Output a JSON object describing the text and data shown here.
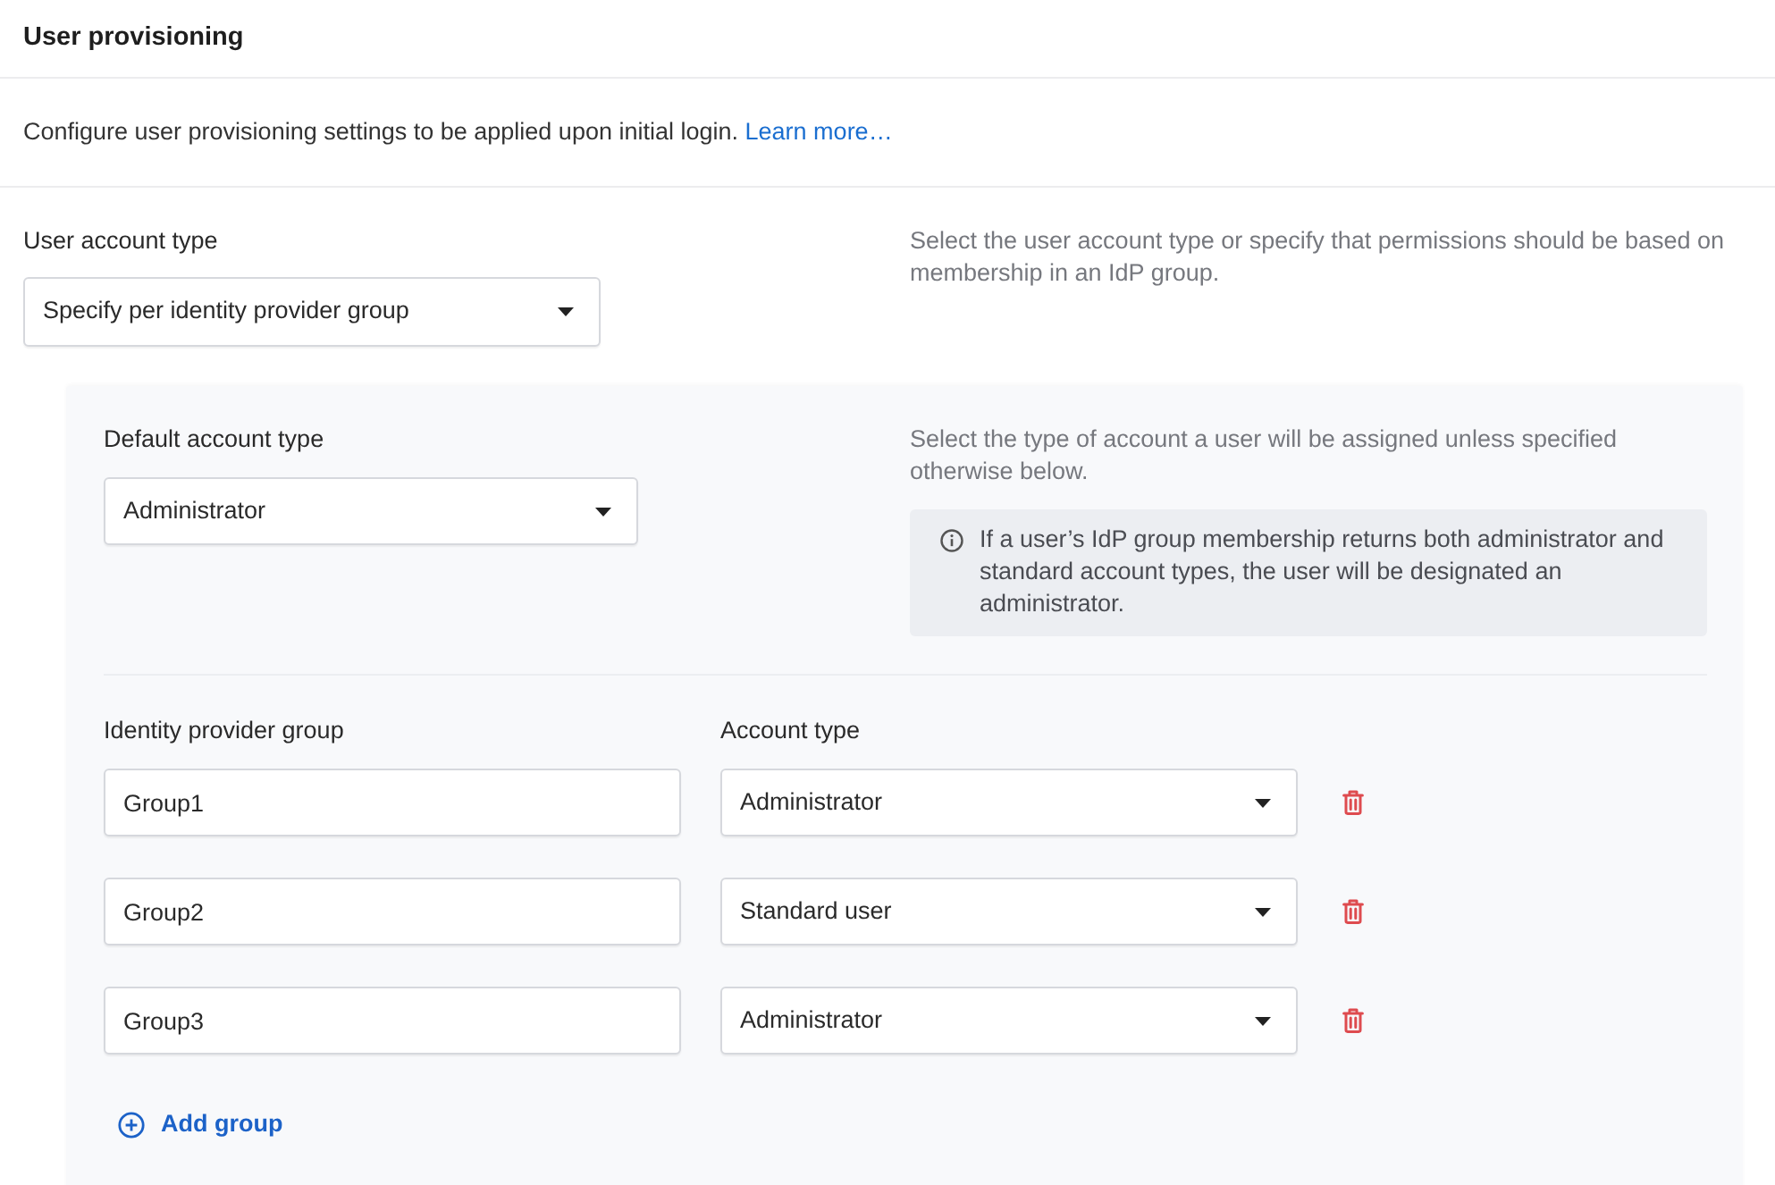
{
  "header": {
    "title": "User provisioning"
  },
  "intro": {
    "text": "Configure user provisioning settings to be applied upon initial login.",
    "link": "Learn more…"
  },
  "user_account_type": {
    "label": "User account type",
    "value": "Specify per identity provider group",
    "help": "Select the user account type or specify that permissions should be based on membership in an IdP group."
  },
  "group_panel": {
    "default_account_type": {
      "label": "Default account type",
      "value": "Administrator",
      "help": "Select the type of account a user will be assigned unless specified otherwise below.",
      "notice": "If a user’s IdP group membership returns both administrator and standard account types, the user will be designated an administrator."
    },
    "columns": [
      "Identity provider group",
      "Account type"
    ],
    "rows": [
      {
        "group": "Group1",
        "account_type": "Administrator"
      },
      {
        "group": "Group2",
        "account_type": "Standard user"
      },
      {
        "group": "Group3",
        "account_type": "Administrator"
      }
    ],
    "add_button": "Add group"
  }
}
